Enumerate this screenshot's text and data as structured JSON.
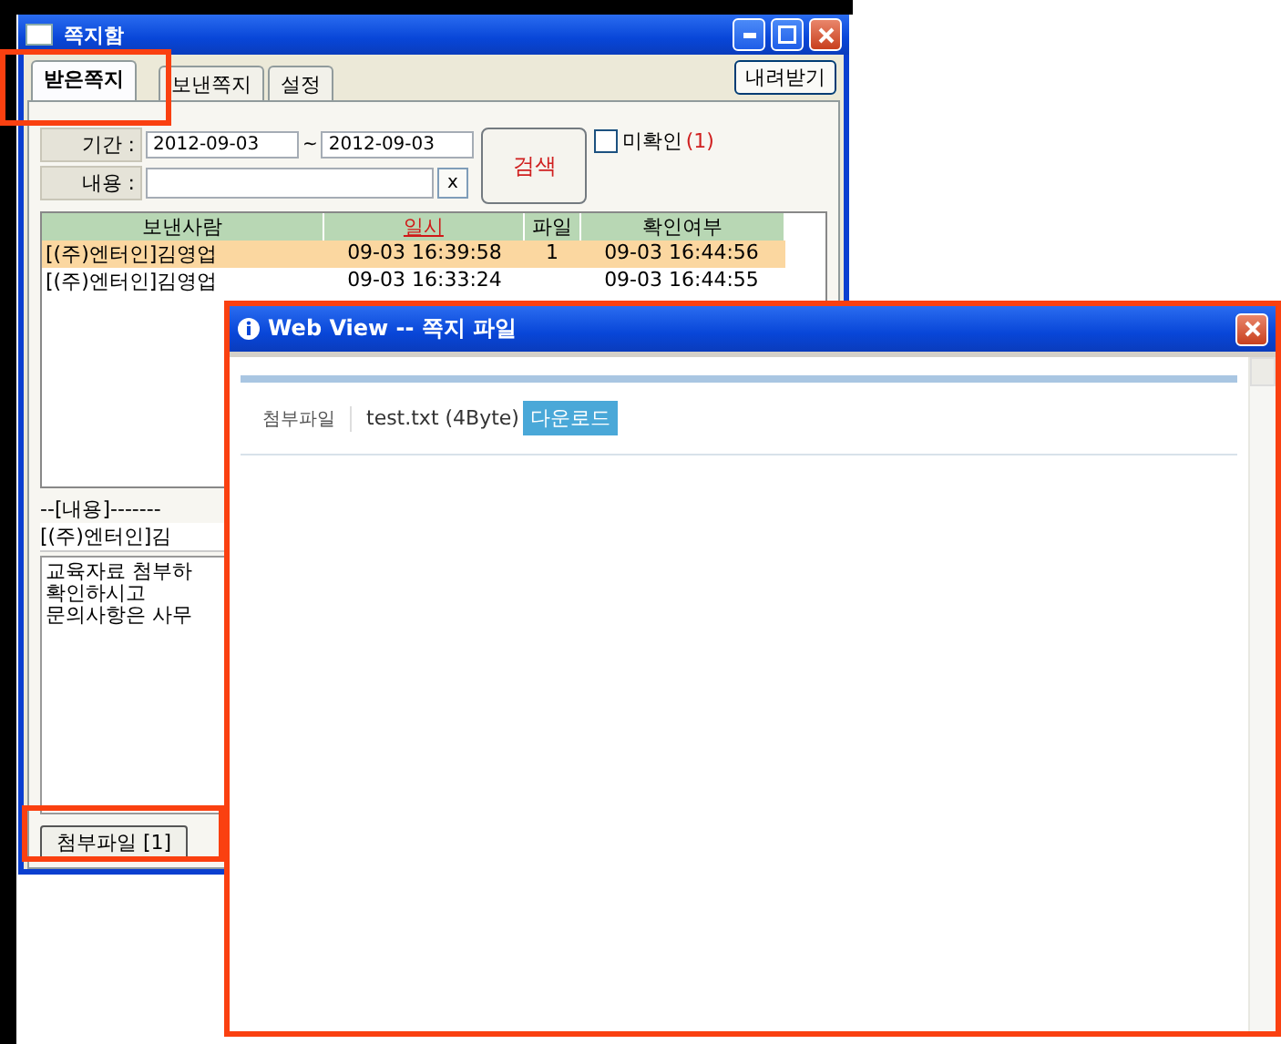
{
  "main_window": {
    "title": "쪽지함",
    "tabs": [
      {
        "label": "받은쪽지",
        "selected": true
      },
      {
        "label": "보낸쪽지",
        "selected": false
      },
      {
        "label": "설정",
        "selected": false
      }
    ],
    "download_button": "내려받기",
    "filter": {
      "period_label": "기간 :",
      "date_from": "2012-09-03",
      "separator": "~",
      "date_to": "2012-09-03",
      "content_label": "내용 :",
      "clear_button": "x",
      "search_button": "검색",
      "unread_label": "미확인",
      "unread_count": "(1)",
      "unread_checked": false
    },
    "table": {
      "columns": [
        {
          "label": "보낸사람",
          "sorted": false
        },
        {
          "label": "일시",
          "sorted": true
        },
        {
          "label": "파일",
          "sorted": false
        },
        {
          "label": "확인여부",
          "sorted": false
        }
      ],
      "rows": [
        {
          "cells": [
            "[(주)엔터인]김영업",
            "09-03 16:39:58",
            "1",
            "09-03 16:44:56"
          ],
          "selected": true
        },
        {
          "cells": [
            "[(주)엔터인]김영업",
            "09-03 16:33:24",
            "",
            "09-03 16:44:55"
          ],
          "selected": false
        }
      ]
    },
    "content_header": "--[내용]-------",
    "content_sender": "[(주)엔터인]김",
    "content_lines": [
      "교육자료 첨부하",
      "확인하시고",
      "문의사항은 사무"
    ],
    "attachment_button": "첨부파일 [1]"
  },
  "dialog": {
    "title": "Web View -- 쪽지 파일",
    "attachment_label": "첨부파일",
    "file_name": "test.txt (4Byte)",
    "download_button": "다운로드"
  }
}
